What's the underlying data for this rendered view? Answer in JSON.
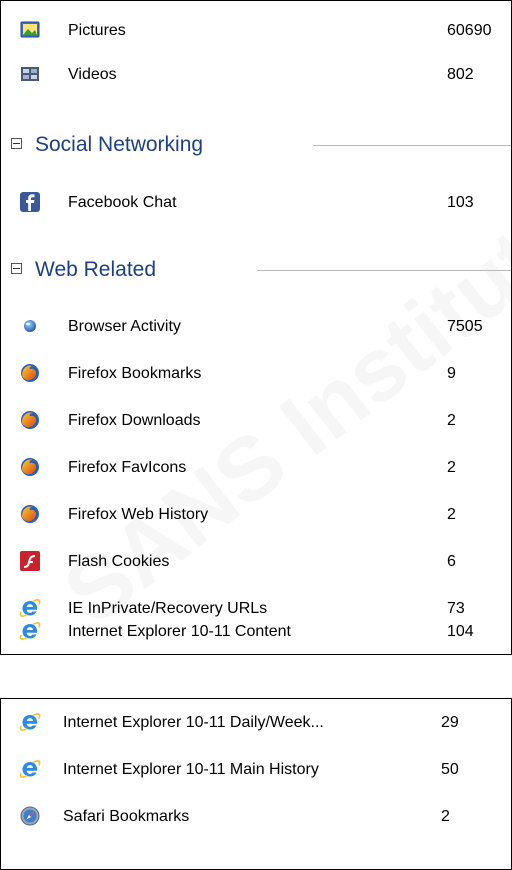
{
  "panel1": {
    "rows_top": [
      {
        "label": "Pictures",
        "count": "60690",
        "icon": "pictures-icon"
      },
      {
        "label": "Videos",
        "count": "802",
        "icon": "videos-icon"
      }
    ],
    "social_group": {
      "title": "Social Networking"
    },
    "social_rows": [
      {
        "label": "Facebook Chat",
        "count": "103",
        "icon": "facebook-icon"
      }
    ],
    "web_group": {
      "title": "Web Related"
    },
    "web_rows": [
      {
        "label": "Browser Activity",
        "count": "7505",
        "icon": "browser-activity-icon"
      },
      {
        "label": "Firefox Bookmarks",
        "count": "9",
        "icon": "firefox-icon"
      },
      {
        "label": "Firefox Downloads",
        "count": "2",
        "icon": "firefox-icon"
      },
      {
        "label": "Firefox FavIcons",
        "count": "2",
        "icon": "firefox-icon"
      },
      {
        "label": "Firefox Web History",
        "count": "2",
        "icon": "firefox-icon"
      },
      {
        "label": "Flash Cookies",
        "count": "6",
        "icon": "flash-icon"
      },
      {
        "label": "IE InPrivate/Recovery URLs",
        "count": "73",
        "icon": "ie-icon"
      },
      {
        "label": "Internet Explorer 10-11 Content",
        "count": "104",
        "icon": "ie-icon"
      }
    ]
  },
  "panel2": {
    "rows": [
      {
        "label": "Internet Explorer 10-11 Daily/Week...",
        "count": "29",
        "icon": "ie-icon"
      },
      {
        "label": "Internet Explorer 10-11 Main History",
        "count": "50",
        "icon": "ie-icon"
      },
      {
        "label": "Safari Bookmarks",
        "count": "2",
        "icon": "safari-icon"
      }
    ]
  },
  "watermark": "SANS Institute"
}
